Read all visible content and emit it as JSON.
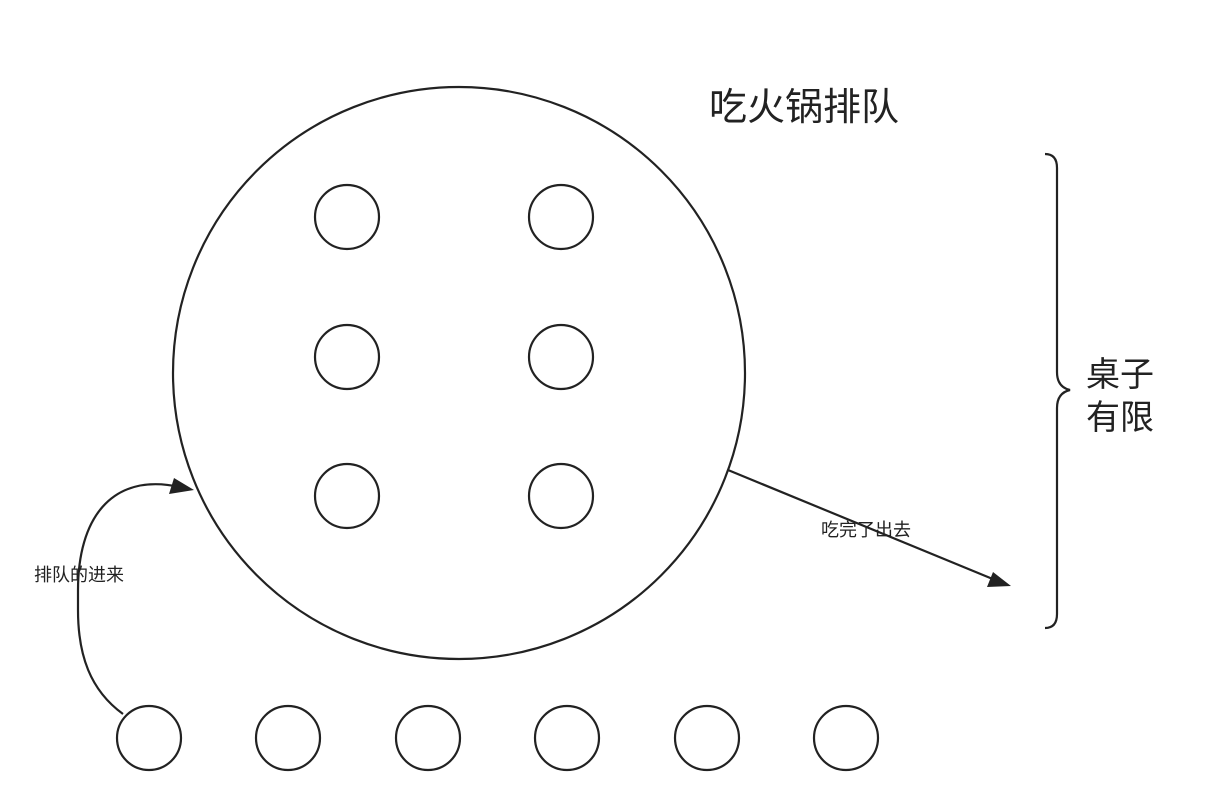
{
  "title": "吃火锅排队",
  "brace_label_line1": "桌子",
  "brace_label_line2": "有限",
  "enter_label": "排队的进来",
  "exit_label": "吃完了出去",
  "tables_inside_count": 6,
  "queue_count": 6,
  "colors": {
    "stroke": "#222222",
    "background": "#ffffff"
  }
}
